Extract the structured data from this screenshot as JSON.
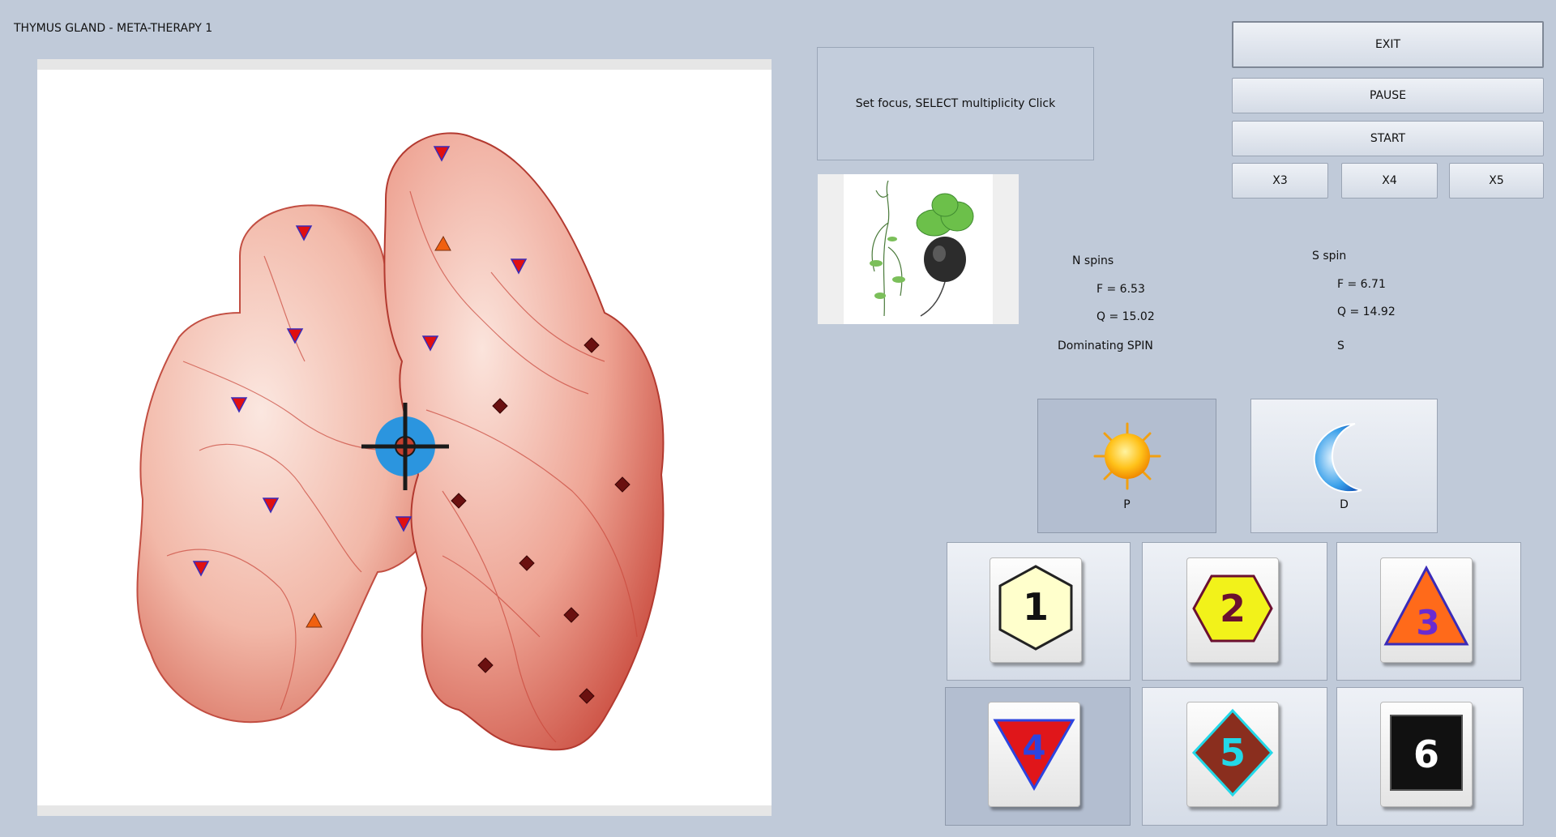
{
  "window": {
    "title": "THYMUS GLAND - META-THERAPY 1"
  },
  "message": {
    "text": "Set focus, SELECT multiplicity Click"
  },
  "controls": {
    "exit": "EXIT",
    "pause": "PAUSE",
    "start": "START",
    "x3": "X3",
    "x4": "X4",
    "x5": "X5"
  },
  "spins": {
    "n_title": "N spins",
    "n_f": "F =  6.53",
    "n_q": "Q = 15.02",
    "s_title": "S spin",
    "s_f": "F =  6.71",
    "s_q": "Q = 14.92",
    "dominating_label": "Dominating SPIN",
    "dominating_value": "S"
  },
  "modes": {
    "p_label": "P",
    "d_label": "D",
    "selected": "P"
  },
  "levels": {
    "selected": "4",
    "items": [
      {
        "number": "1",
        "shape": "hexagon",
        "fill": "#ffffcc",
        "text_color": "#111111"
      },
      {
        "number": "2",
        "shape": "hexagon",
        "fill": "#f2f21a",
        "text_color": "#6b1030"
      },
      {
        "number": "3",
        "shape": "triangle-up",
        "fill": "#ff6a1a",
        "text_color": "#6a2bd0"
      },
      {
        "number": "4",
        "shape": "triangle-down",
        "fill": "#e0161a",
        "text_color": "#2c44e0"
      },
      {
        "number": "5",
        "shape": "diamond",
        "fill": "#8a2e1e",
        "text_color": "#23d8e8"
      },
      {
        "number": "6",
        "shape": "square",
        "fill": "#111111",
        "text_color": "#ffffff"
      }
    ]
  },
  "colors": {
    "background": "#c0cad9",
    "marker_red": "#e01010",
    "marker_orange": "#f06010",
    "marker_diamond": "#6a1010",
    "target": "#2b95df"
  }
}
